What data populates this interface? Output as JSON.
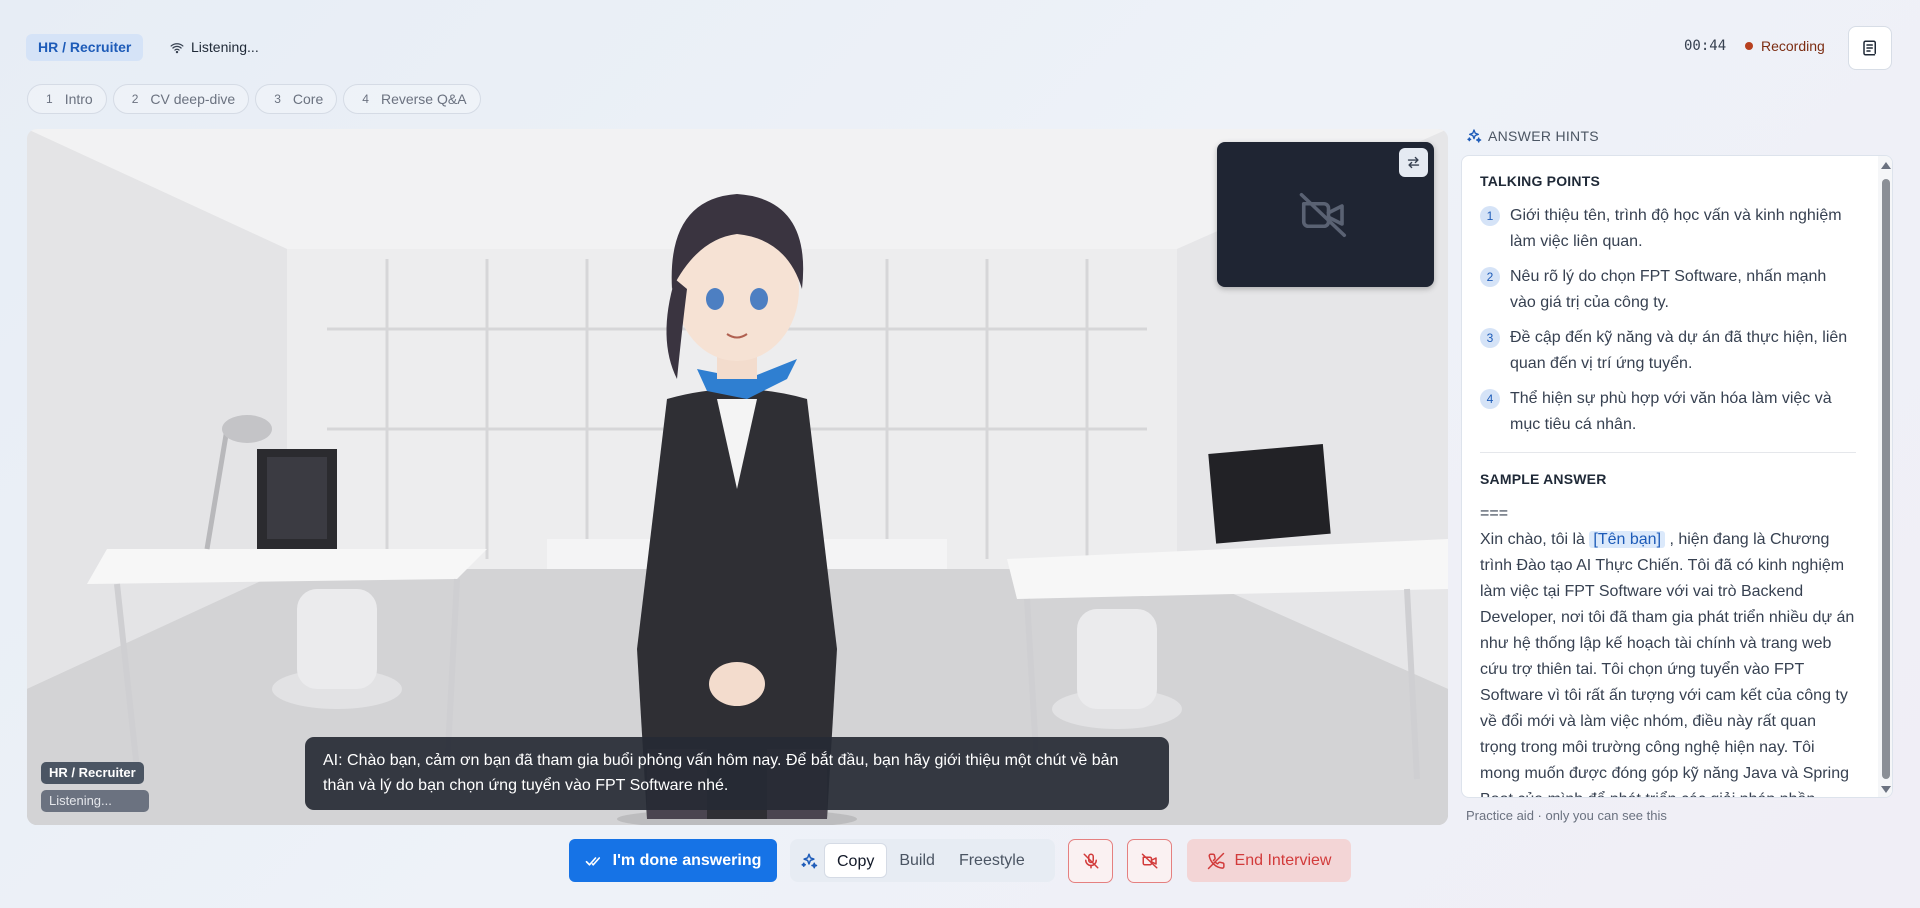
{
  "header": {
    "role_badge": "HR / Recruiter",
    "status": "Listening...",
    "timer": "00:44",
    "recording_label": "Recording",
    "notes_icon": "notes-icon"
  },
  "steps": [
    {
      "num": "1",
      "label": "Intro"
    },
    {
      "num": "2",
      "label": "CV deep-dive"
    },
    {
      "num": "3",
      "label": "Core"
    },
    {
      "num": "4",
      "label": "Reverse Q&A"
    }
  ],
  "stage": {
    "role_tag": "HR / Recruiter",
    "status_tag": "Listening...",
    "caption": "AI: Chào bạn, cảm ơn bạn đã tham gia buổi phỏng vấn hôm nay. Để bắt đầu, bạn hãy giới thiệu một chút về bản thân và lý do bạn chọn ứng tuyển vào FPT Software nhé.",
    "self_cam_icon": "camera-off-icon",
    "swap_icon": "swap-icon"
  },
  "hints": {
    "header": "ANSWER HINTS",
    "talking_points_title": "TALKING POINTS",
    "talking_points": [
      {
        "num": "1",
        "text": "Giới thiệu tên, trình độ học vấn và kinh nghiệm làm việc liên quan."
      },
      {
        "num": "2",
        "text": "Nêu rõ lý do chọn FPT Software, nhấn mạnh vào giá trị của công ty."
      },
      {
        "num": "3",
        "text": "Đề cập đến kỹ năng và dự án đã thực hiện, liên quan đến vị trí ứng tuyển."
      },
      {
        "num": "4",
        "text": "Thể hiện sự phù hợp với văn hóa làm việc và mục tiêu cá nhân."
      }
    ],
    "sample_title": "SAMPLE ANSWER",
    "sample_sep": "===",
    "sample_before": "Xin chào, tôi là ",
    "sample_placeholder": "[Tên bạn]",
    "sample_after": " , hiện đang là Chương trình Đào tạo AI Thực Chiến. Tôi đã có kinh nghiệm làm việc tại FPT Software với vai trò Backend Developer, nơi tôi đã tham gia phát triển nhiều dự án như hệ thống lập kế hoạch tài chính và trang web cứu trợ thiên tai. Tôi chọn ứng tuyển vào FPT Software vì tôi rất ấn tượng với cam kết của công ty về đổi mới và làm việc nhóm, điều này rất quan trọng trong môi trường công nghệ hiện nay. Tôi mong muốn được đóng góp kỹ năng Java và Spring Boot của mình để phát triển các giải pháp phần",
    "footer": "Practice aid · only you can see this"
  },
  "controls": {
    "done_label": "I'm done answering",
    "modes": [
      "Copy",
      "Build",
      "Freestyle"
    ],
    "active_mode": "Copy",
    "end_label": "End Interview"
  },
  "colors": {
    "accent": "#1673e6",
    "danger": "#d23b3b",
    "recording": "#b7401f"
  }
}
